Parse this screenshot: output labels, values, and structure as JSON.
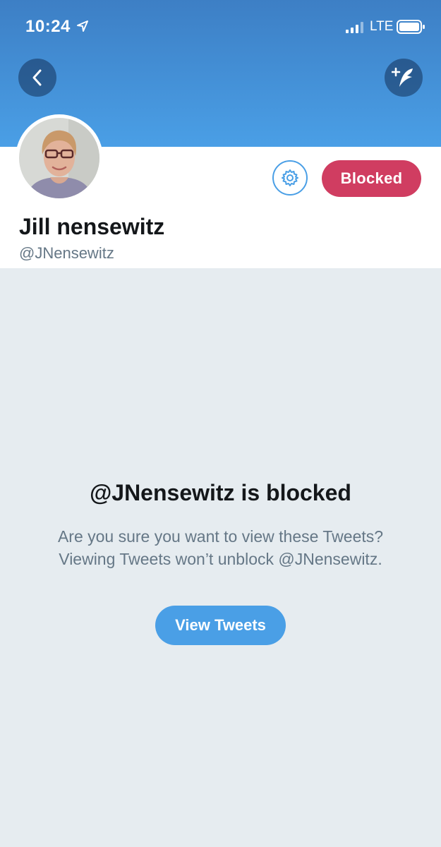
{
  "status_bar": {
    "time": "10:24",
    "network": "LTE"
  },
  "profile": {
    "display_name": "Jill nensewitz",
    "handle": "@JNensewitz",
    "blocked_label": "Blocked"
  },
  "blocked_notice": {
    "title": "@JNensewitz is blocked",
    "line1": "Are you sure you want to view these Tweets?",
    "line2": "Viewing Tweets won’t unblock @JNensewitz.",
    "button_label": "View Tweets"
  },
  "icons": {
    "location": "location-arrow-icon",
    "signal": "cellular-signal-icon",
    "battery": "battery-icon",
    "back": "chevron-left-icon",
    "compose": "compose-tweet-icon",
    "settings": "gear-icon"
  },
  "colors": {
    "header_top": "#3d7fc5",
    "header_bottom": "#4a9fe6",
    "accent_blue": "#4a9fe6",
    "blocked_red": "#d03d61",
    "background": "#e6ecf0"
  }
}
